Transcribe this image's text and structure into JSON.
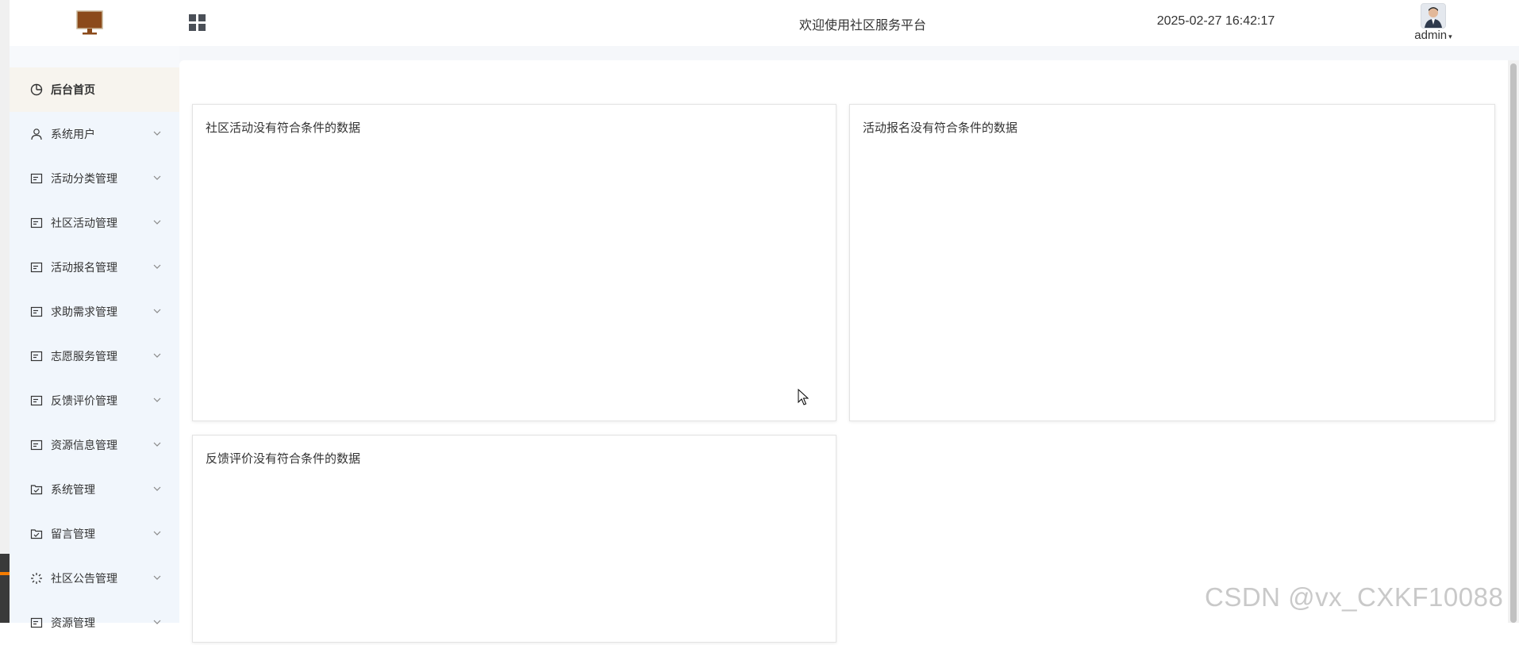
{
  "header": {
    "title": "欢迎使用社区服务平台",
    "datetime": "2025-02-27 16:42:17",
    "user_name": "admin"
  },
  "sidebar": {
    "items": [
      {
        "label": "后台首页",
        "icon": "clock-icon",
        "active": true
      },
      {
        "label": "系统用户",
        "icon": "user-icon"
      },
      {
        "label": "活动分类管理",
        "icon": "list-icon"
      },
      {
        "label": "社区活动管理",
        "icon": "list-icon"
      },
      {
        "label": "活动报名管理",
        "icon": "list-icon"
      },
      {
        "label": "求助需求管理",
        "icon": "list-icon"
      },
      {
        "label": "志愿服务管理",
        "icon": "list-icon"
      },
      {
        "label": "反馈评价管理",
        "icon": "list-icon"
      },
      {
        "label": "资源信息管理",
        "icon": "list-icon"
      },
      {
        "label": "系统管理",
        "icon": "check-box-icon"
      },
      {
        "label": "留言管理",
        "icon": "check-box-icon"
      },
      {
        "label": "社区公告管理",
        "icon": "loading-icon"
      },
      {
        "label": "资源管理",
        "icon": "list-icon"
      }
    ]
  },
  "main": {
    "cards": [
      {
        "text": "社区活动没有符合条件的数据"
      },
      {
        "text": "活动报名没有符合条件的数据"
      },
      {
        "text": "反馈评价没有符合条件的数据"
      }
    ]
  },
  "watermark": "CSDN @vx_CXKF10088",
  "colors": {
    "sidebar_bg": "#f1f6fc",
    "active_item_bg": "#f7f4ee",
    "logo_brown": "#8b4a1a"
  }
}
